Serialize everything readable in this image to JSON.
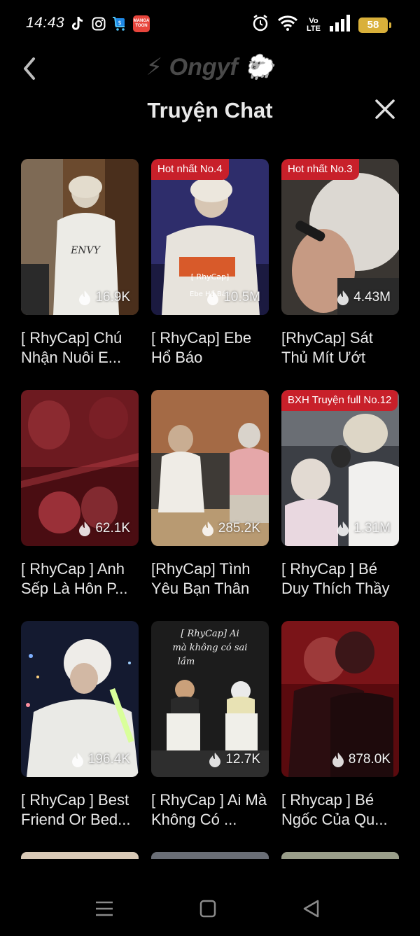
{
  "status_bar": {
    "time": "14:43",
    "apps": [
      "tiktok-icon",
      "instagram-icon",
      "shopping-cart-icon",
      "mangatoon-icon"
    ],
    "mangatoon_label": "MANGA TOON",
    "volte_top": "Vo",
    "volte_bottom": "LTE",
    "battery": "58"
  },
  "header": {
    "brand": "⚡ Ongyf 🐑",
    "title": "Truyện Chat"
  },
  "cards": [
    {
      "title": "[ RhyCap] Chú Nhận Nuôi E...",
      "views": "16.9K",
      "badge": ""
    },
    {
      "title": "[ RhyCap] Ebe Hổ Báo",
      "views": "10.5M",
      "badge": "Hot nhất No.4"
    },
    {
      "title": "[RhyCap] Sát Thủ Mít Ướt",
      "views": "4.43M",
      "badge": "Hot nhất No.3"
    },
    {
      "title": "[ RhyCap ] Anh Sếp Là Hôn P...",
      "views": "62.1K",
      "badge": ""
    },
    {
      "title": "[RhyCap] Tình Yêu Bạn Thân",
      "views": "285.2K",
      "badge": ""
    },
    {
      "title": "[ RhyCap ] Bé Duy Thích Thầy",
      "views": "1.31M",
      "badge": "BXH Truyện full No.12"
    },
    {
      "title": "[ RhyCap ] Best Friend Or Bed...",
      "views": "196.4K",
      "badge": ""
    },
    {
      "title": "[ RhyCap ] Ai Mà Không Có ...",
      "views": "12.7K",
      "badge": ""
    },
    {
      "title": "[ Rhycap ] Bé Ngốc Của Qu...",
      "views": "878.0K",
      "badge": ""
    }
  ],
  "cover_texts": {
    "card2_caption": "[ RhyCap]",
    "card2_sub": "Ebe Hổ Báo",
    "card8_line1": "[ RhyCap] Ai",
    "card8_line2": "mà không có sai",
    "card8_line3": "lầm"
  },
  "colors": {
    "background": "#000000",
    "badge": "#c8202a",
    "battery": "#d9b03a",
    "brand": "#4a4a4a"
  }
}
